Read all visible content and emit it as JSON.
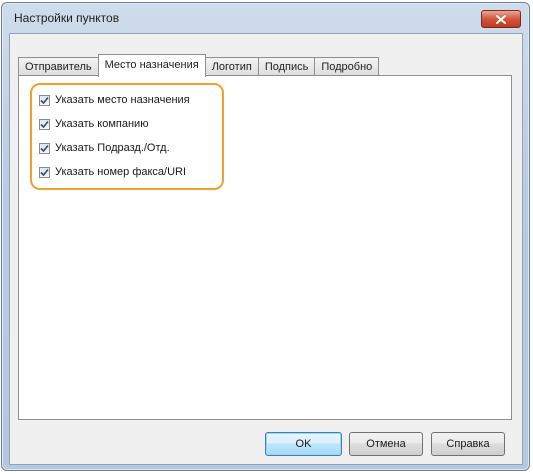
{
  "window": {
    "title": "Настройки пунктов",
    "close_icon": "close-icon"
  },
  "tabs": [
    {
      "label": "Отправитель",
      "active": false
    },
    {
      "label": "Место назначения",
      "active": true
    },
    {
      "label": "Логотип",
      "active": false
    },
    {
      "label": "Подпись",
      "active": false
    },
    {
      "label": "Подробно",
      "active": false
    }
  ],
  "options": [
    {
      "label": "Указать место назначения",
      "checked": true
    },
    {
      "label": "Указать компанию",
      "checked": true
    },
    {
      "label": "Указать Подразд./Отд.",
      "checked": true
    },
    {
      "label": "Указать номер факса/URI",
      "checked": true
    }
  ],
  "buttons": {
    "ok": "OK",
    "cancel": "Отмена",
    "help": "Справка"
  },
  "colors": {
    "highlight": "#f0a030",
    "close": "#c94a30",
    "check": "#2c4c8a"
  }
}
